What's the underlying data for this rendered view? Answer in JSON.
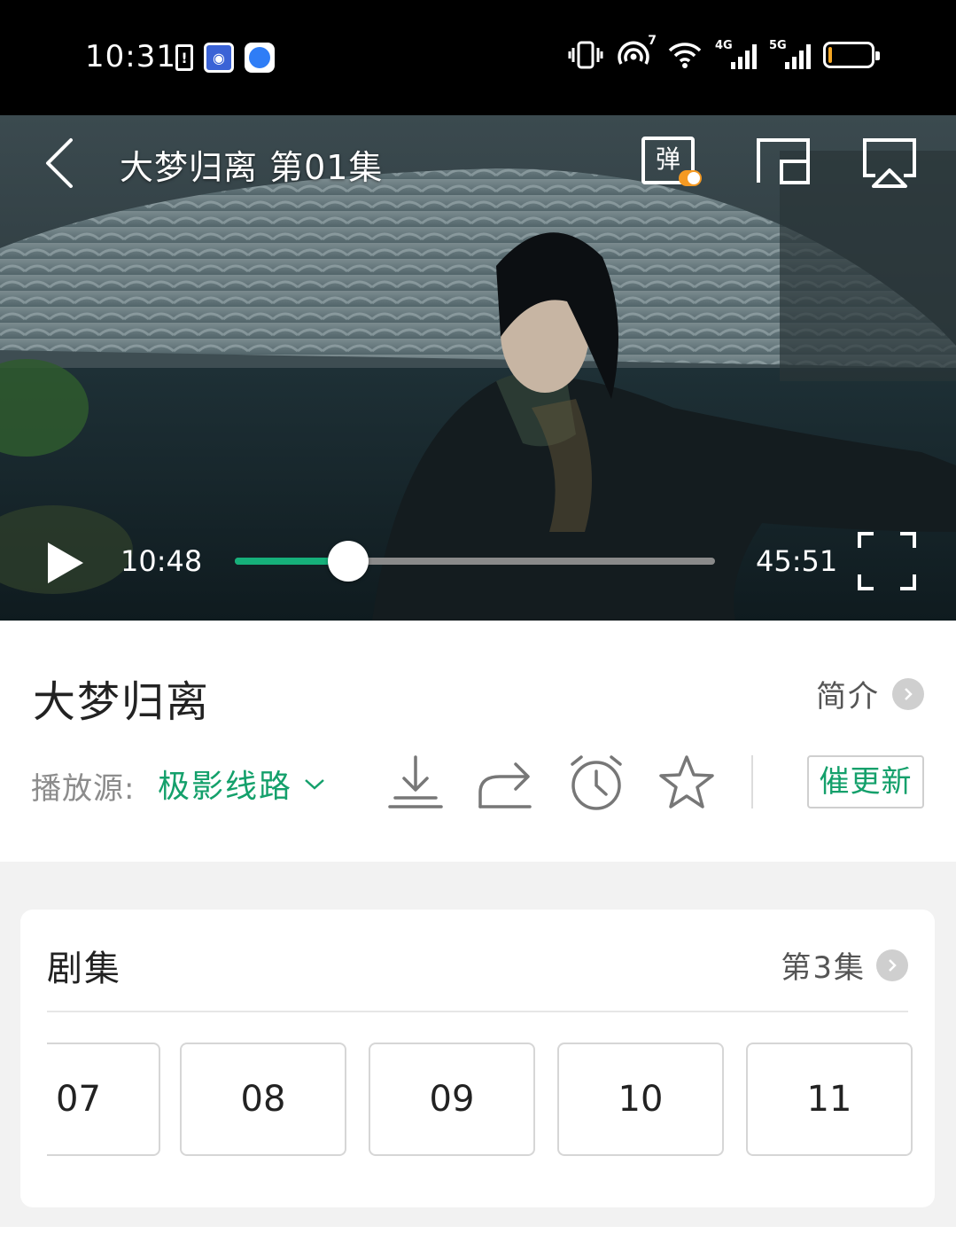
{
  "status_bar": {
    "time": "10:31",
    "left_icons": [
      "battery-alert-icon",
      "tieba-app-icon",
      "blue-dot-app-icon"
    ],
    "right_icons": [
      "vibrate-icon",
      "hotspot-icon",
      "wifi-icon",
      "signal-4g-icon",
      "signal-5g-icon",
      "battery-icon"
    ],
    "hotspot_count": "7",
    "sig1_label": "4G",
    "sig2_label": "5G",
    "battery_level": 0.2,
    "battery_color": "#f5a623"
  },
  "player": {
    "title": "大梦归离 第01集",
    "danmaku_label": "弹",
    "current_time": "10:48",
    "total_time": "45:51",
    "progress": 0.2356,
    "accent_color": "#16b07a"
  },
  "info": {
    "show_title": "大梦归离",
    "intro_label": "简介",
    "source_label": "播放源:",
    "source_value": "极影线路",
    "actions": [
      "download-icon",
      "share-icon",
      "alarm-clock-icon",
      "star-icon"
    ],
    "urge_label": "催更新"
  },
  "episodes": {
    "title": "剧集",
    "current_label": "第3集",
    "items": [
      "07",
      "08",
      "09",
      "10",
      "11"
    ]
  }
}
